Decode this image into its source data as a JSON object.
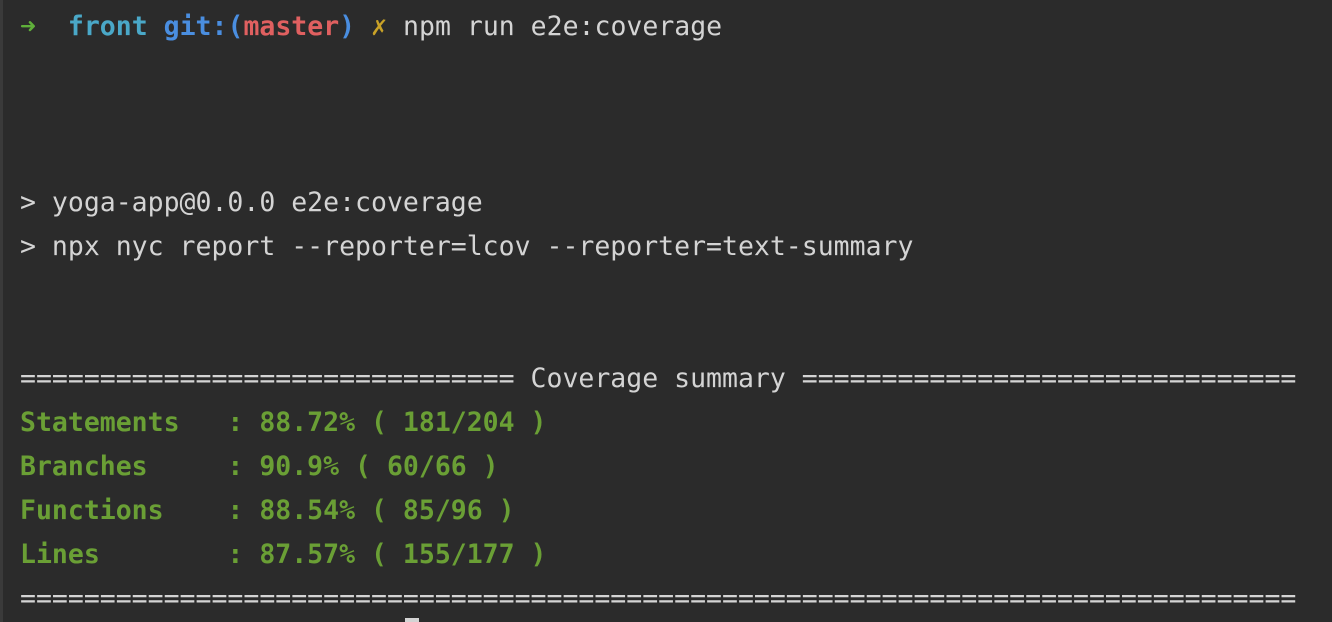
{
  "prompt": {
    "arrow": "➜",
    "dir": "front",
    "git_label": "git:",
    "paren_open": "(",
    "branch": "master",
    "paren_close": ")",
    "dirty_mark": "✗",
    "command": "npm run e2e:coverage"
  },
  "script_lines": [
    "> yoga-app@0.0.0 e2e:coverage",
    "> npx nyc report --reporter=lcov --reporter=text-summary"
  ],
  "summary": {
    "header": "=============================== Coverage summary ===============================",
    "rows": [
      {
        "text": "Statements   : 88.72% ( 181/204 )"
      },
      {
        "text": "Branches     : 90.9% ( 60/66 )"
      },
      {
        "text": "Functions    : 88.54% ( 85/96 )"
      },
      {
        "text": "Lines        : 87.57% ( 155/177 )"
      }
    ],
    "footer": "================================================================================"
  }
}
